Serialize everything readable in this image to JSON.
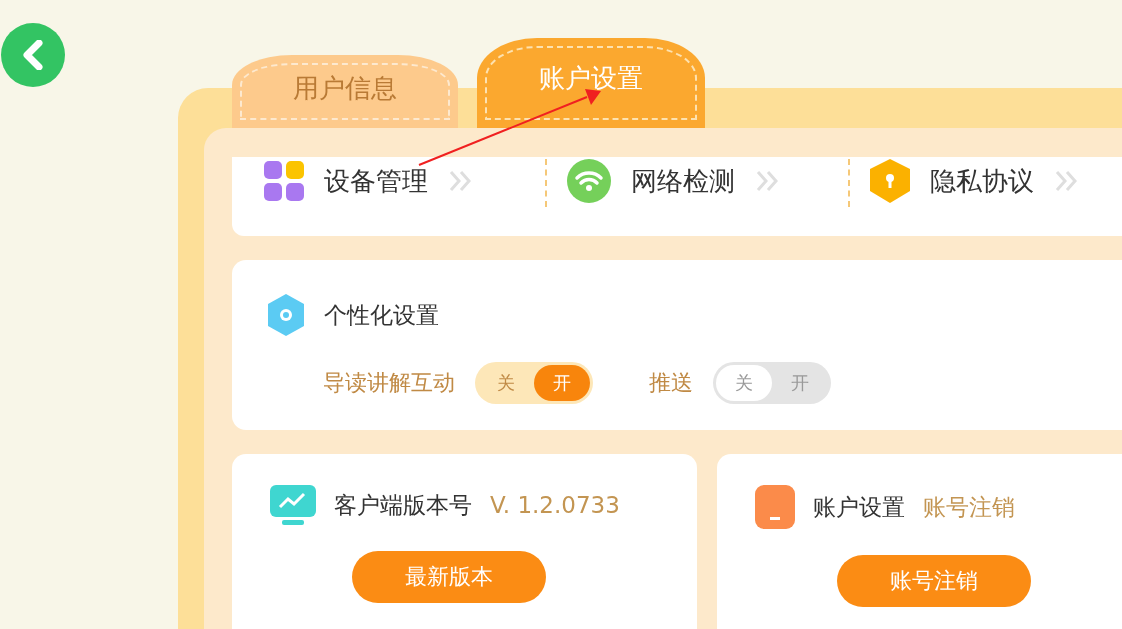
{
  "tabs": [
    {
      "label": "用户信息",
      "selected": false
    },
    {
      "label": "账户设置",
      "selected": true
    }
  ],
  "quick_links": [
    {
      "label": "设备管理"
    },
    {
      "label": "网络检测"
    },
    {
      "label": "隐私协议"
    }
  ],
  "personalization": {
    "title": "个性化设置",
    "toggles": [
      {
        "label": "导读讲解互动",
        "off_label": "关",
        "on_label": "开",
        "on": true
      },
      {
        "label": "推送",
        "off_label": "关",
        "on_label": "开",
        "on": false
      }
    ]
  },
  "cards": [
    {
      "title": "客户端版本号",
      "value": "V. 1.2.0733",
      "button": "最新版本"
    },
    {
      "title": "账户设置",
      "value": "账号注销",
      "button": "账号注销"
    }
  ]
}
